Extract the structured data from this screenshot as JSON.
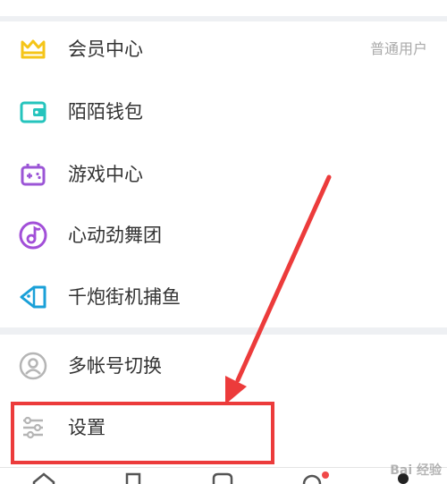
{
  "menu_group_1": [
    {
      "label": "会员中心",
      "right_text": "普通用户",
      "icon": "crown-icon",
      "color": "#f5c518"
    },
    {
      "label": "陌陌钱包",
      "icon": "wallet-icon",
      "color": "#25c4bd"
    },
    {
      "label": "游戏中心",
      "icon": "gamepad-icon",
      "color": "#9b55d6"
    },
    {
      "label": "心动劲舞团",
      "icon": "music-note-icon",
      "color": "#a24fd8"
    },
    {
      "label": "千炮街机捕鱼",
      "icon": "fish-icon",
      "color": "#1aa0d8"
    }
  ],
  "menu_group_2": [
    {
      "label": "多帐号切换",
      "icon": "account-switch-icon",
      "color": "#b5b5b5"
    },
    {
      "label": "设置",
      "icon": "settings-sliders-icon",
      "color": "#b5b5b5"
    }
  ],
  "bottom_nav": [
    {
      "icon": "home-icon"
    },
    {
      "icon": "bookmark-icon"
    },
    {
      "icon": "chat-icon"
    },
    {
      "icon": "location-icon",
      "badge": true
    },
    {
      "icon": "profile-icon"
    }
  ],
  "colors": {
    "highlight": "#ec3b3b",
    "badge": "#f04848"
  },
  "watermark": "Bai 经验"
}
